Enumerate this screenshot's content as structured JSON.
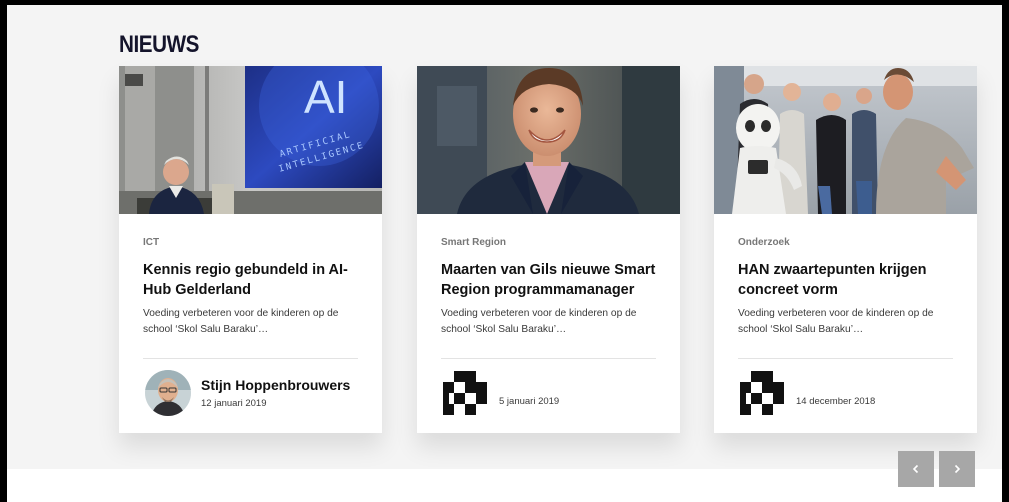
{
  "section": {
    "title": "NIEUWS"
  },
  "colors": {
    "title": "#14142b",
    "nav_button": "#a7a7a7",
    "band": "#f4f4f4"
  },
  "cards": [
    {
      "image": "ai-lecture-photo",
      "category": "ICT",
      "headline": "Kennis regio gebundeld in AI-Hub Gelderland",
      "excerpt": "Voeding verbeteren voor de kinderen op de school ‘Skol Salu Baraku’…",
      "author": "Stijn Hoppenbrouwers",
      "date": "12 januari 2019"
    },
    {
      "image": "smiling-man-portrait",
      "category": "Smart Region",
      "headline": "Maarten van Gils nieuwe Smart Region programmamanager",
      "excerpt": "Voeding verbeteren voor de kinderen op de school ‘Skol Salu Baraku’…",
      "author": "",
      "date": "5 januari 2019"
    },
    {
      "image": "robot-group-photo",
      "category": "Onderzoek",
      "headline": "HAN zwaartepunten krijgen concreet vorm",
      "excerpt": "Voeding verbeteren voor de kinderen op de school ‘Skol Salu Baraku’…",
      "author": "",
      "date": "14 december 2018"
    }
  ],
  "images": {
    "screen_text_big": "AI",
    "screen_text_small_1": "ARTIFICIAL",
    "screen_text_small_2": "INTELLIGENCE"
  },
  "carousel": {
    "prev_icon": "chevron-left-icon",
    "next_icon": "chevron-right-icon"
  }
}
